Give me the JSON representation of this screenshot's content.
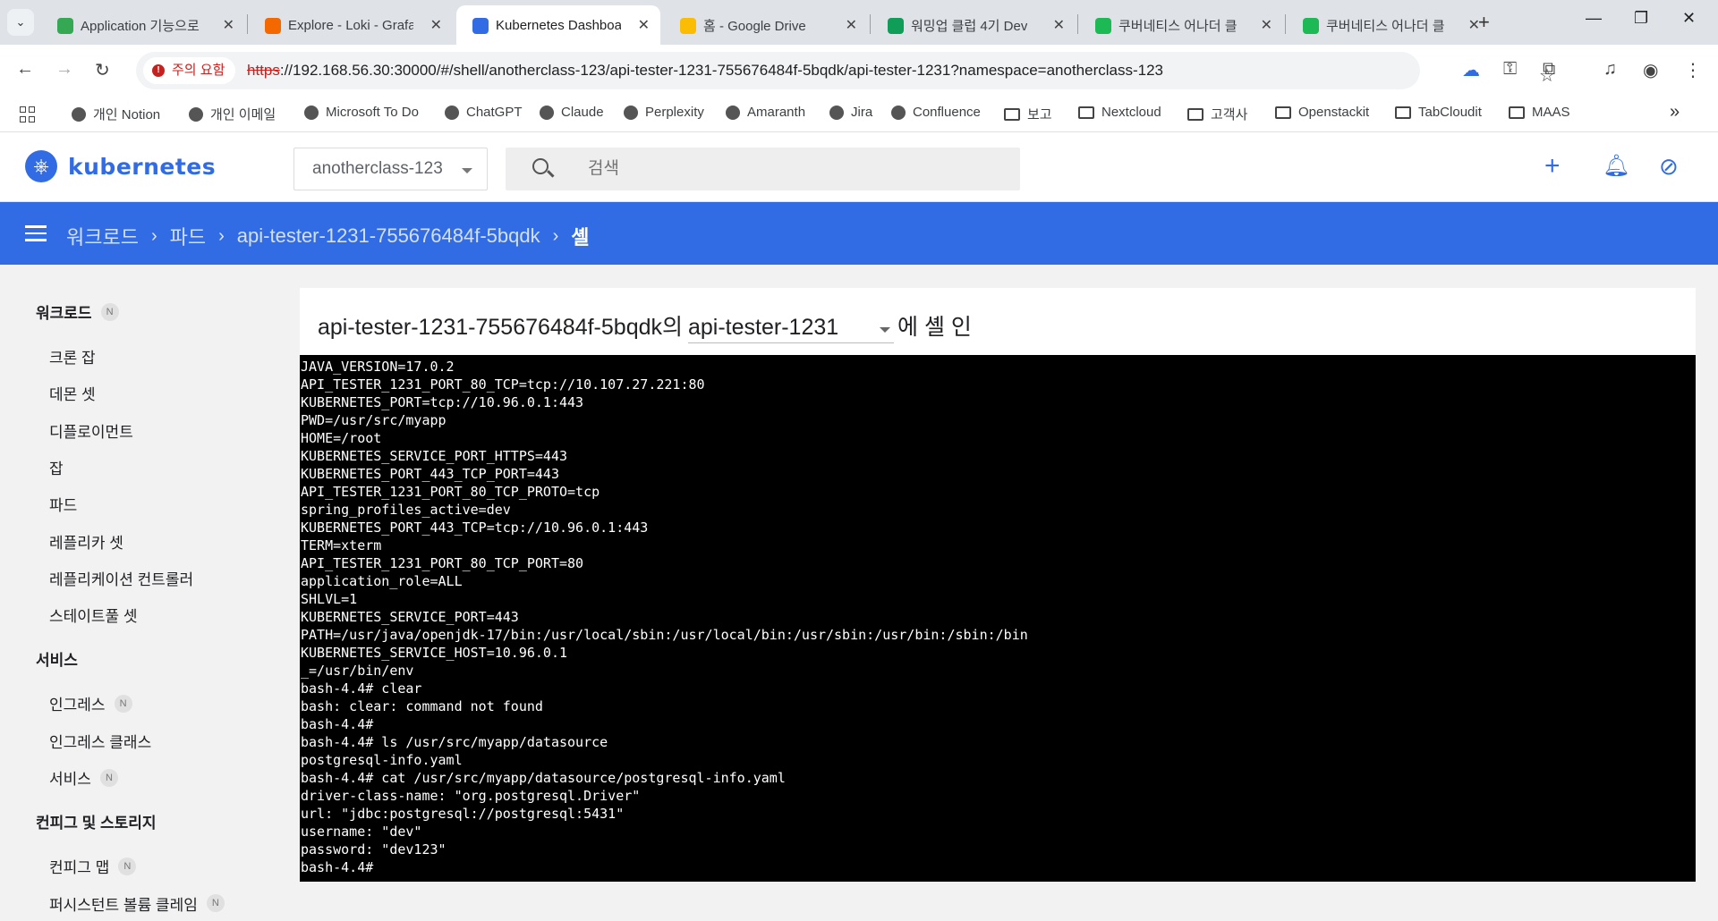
{
  "browser": {
    "tabs": [
      {
        "title": "Application 기능으로",
        "favicon_color": "#34a853",
        "active": false
      },
      {
        "title": "Explore - Loki - Grafana",
        "favicon_color": "#f46800",
        "active": false
      },
      {
        "title": "Kubernetes Dashboard",
        "favicon_color": "#326ce5",
        "active": true
      },
      {
        "title": "홈 - Google Drive",
        "favicon_color": "#fbbc04",
        "active": false
      },
      {
        "title": "워밍업 클럽 4기 Dev",
        "favicon_color": "#0f9d58",
        "active": false
      },
      {
        "title": "쿠버네티스 어나더 클",
        "favicon_color": "#1db954",
        "active": false
      },
      {
        "title": "쿠버네티스 어나더 클",
        "favicon_color": "#1db954",
        "active": false
      }
    ],
    "address": {
      "warning": "주의 요함",
      "url_proto": "https",
      "url_rest": "://192.168.56.30:30000/#/shell/anotherclass-123/api-tester-1231-755676484f-5bqdk/api-tester-1231?namespace=anotherclass-123"
    },
    "bookmarks": [
      {
        "label": "개인 Notion",
        "kind": "site"
      },
      {
        "label": "개인 이메일",
        "kind": "site"
      },
      {
        "label": "Microsoft To Do",
        "kind": "site"
      },
      {
        "label": "ChatGPT",
        "kind": "site"
      },
      {
        "label": "Claude",
        "kind": "site"
      },
      {
        "label": "Perplexity",
        "kind": "site"
      },
      {
        "label": "Amaranth",
        "kind": "site"
      },
      {
        "label": "Jira",
        "kind": "site"
      },
      {
        "label": "Confluence",
        "kind": "site"
      },
      {
        "label": "보고",
        "kind": "folder"
      },
      {
        "label": "Nextcloud",
        "kind": "folder"
      },
      {
        "label": "고객사",
        "kind": "folder"
      },
      {
        "label": "Openstackit",
        "kind": "folder"
      },
      {
        "label": "TabCloudit",
        "kind": "folder"
      },
      {
        "label": "MAAS",
        "kind": "folder"
      }
    ]
  },
  "header": {
    "logo_text": "kubernetes",
    "namespace": "anotherclass-123",
    "search_placeholder": "검색"
  },
  "breadcrumbs": [
    "워크로드",
    "파드",
    "api-tester-1231-755676484f-5bqdk",
    "셸"
  ],
  "sidebar": {
    "badge": "N",
    "sections": [
      {
        "label": "워크로드",
        "badge": true,
        "items": [
          {
            "label": "크론 잡",
            "badge": false
          },
          {
            "label": "데몬 셋",
            "badge": false
          },
          {
            "label": "디플로이먼트",
            "badge": false
          },
          {
            "label": "잡",
            "badge": false
          },
          {
            "label": "파드",
            "badge": false
          },
          {
            "label": "레플리카 셋",
            "badge": false
          },
          {
            "label": "레플리케이션 컨트롤러",
            "badge": false
          },
          {
            "label": "스테이트풀 셋",
            "badge": false
          }
        ]
      },
      {
        "label": "서비스",
        "badge": false,
        "items": [
          {
            "label": "인그레스",
            "badge": true
          },
          {
            "label": "인그레스 클래스",
            "badge": false
          },
          {
            "label": "서비스",
            "badge": true
          }
        ]
      },
      {
        "label": "컨피그 및 스토리지",
        "badge": false,
        "items": [
          {
            "label": "컨피그 맵",
            "badge": true
          },
          {
            "label": "퍼시스턴트 볼륨 클레임",
            "badge": true
          }
        ]
      }
    ]
  },
  "shell": {
    "pod_name": "api-tester-1231-755676484f-5bqdk의",
    "container": "api-tester-1231",
    "suffix": "에 셸 인",
    "lines": [
      "JAVA_VERSION=17.0.2",
      "API_TESTER_1231_PORT_80_TCP=tcp://10.107.27.221:80",
      "KUBERNETES_PORT=tcp://10.96.0.1:443",
      "PWD=/usr/src/myapp",
      "HOME=/root",
      "KUBERNETES_SERVICE_PORT_HTTPS=443",
      "KUBERNETES_PORT_443_TCP_PORT=443",
      "API_TESTER_1231_PORT_80_TCP_PROTO=tcp",
      "spring_profiles_active=dev",
      "KUBERNETES_PORT_443_TCP=tcp://10.96.0.1:443",
      "TERM=xterm",
      "API_TESTER_1231_PORT_80_TCP_PORT=80",
      "application_role=ALL",
      "SHLVL=1",
      "KUBERNETES_SERVICE_PORT=443",
      "PATH=/usr/java/openjdk-17/bin:/usr/local/sbin:/usr/local/bin:/usr/sbin:/usr/bin:/sbin:/bin",
      "KUBERNETES_SERVICE_HOST=10.96.0.1",
      "_=/usr/bin/env",
      "bash-4.4# clear",
      "bash: clear: command not found",
      "bash-4.4#",
      "bash-4.4# ls /usr/src/myapp/datasource",
      "postgresql-info.yaml",
      "bash-4.4# cat /usr/src/myapp/datasource/postgresql-info.yaml",
      "driver-class-name: \"org.postgresql.Driver\"",
      "url: \"jdbc:postgresql://postgresql:5431\"",
      "username: \"dev\"",
      "password: \"dev123\"",
      "bash-4.4#"
    ]
  },
  "colors": {
    "brand": "#326ce5",
    "terminal_bg": "#000000",
    "warning": "#c5221f"
  }
}
